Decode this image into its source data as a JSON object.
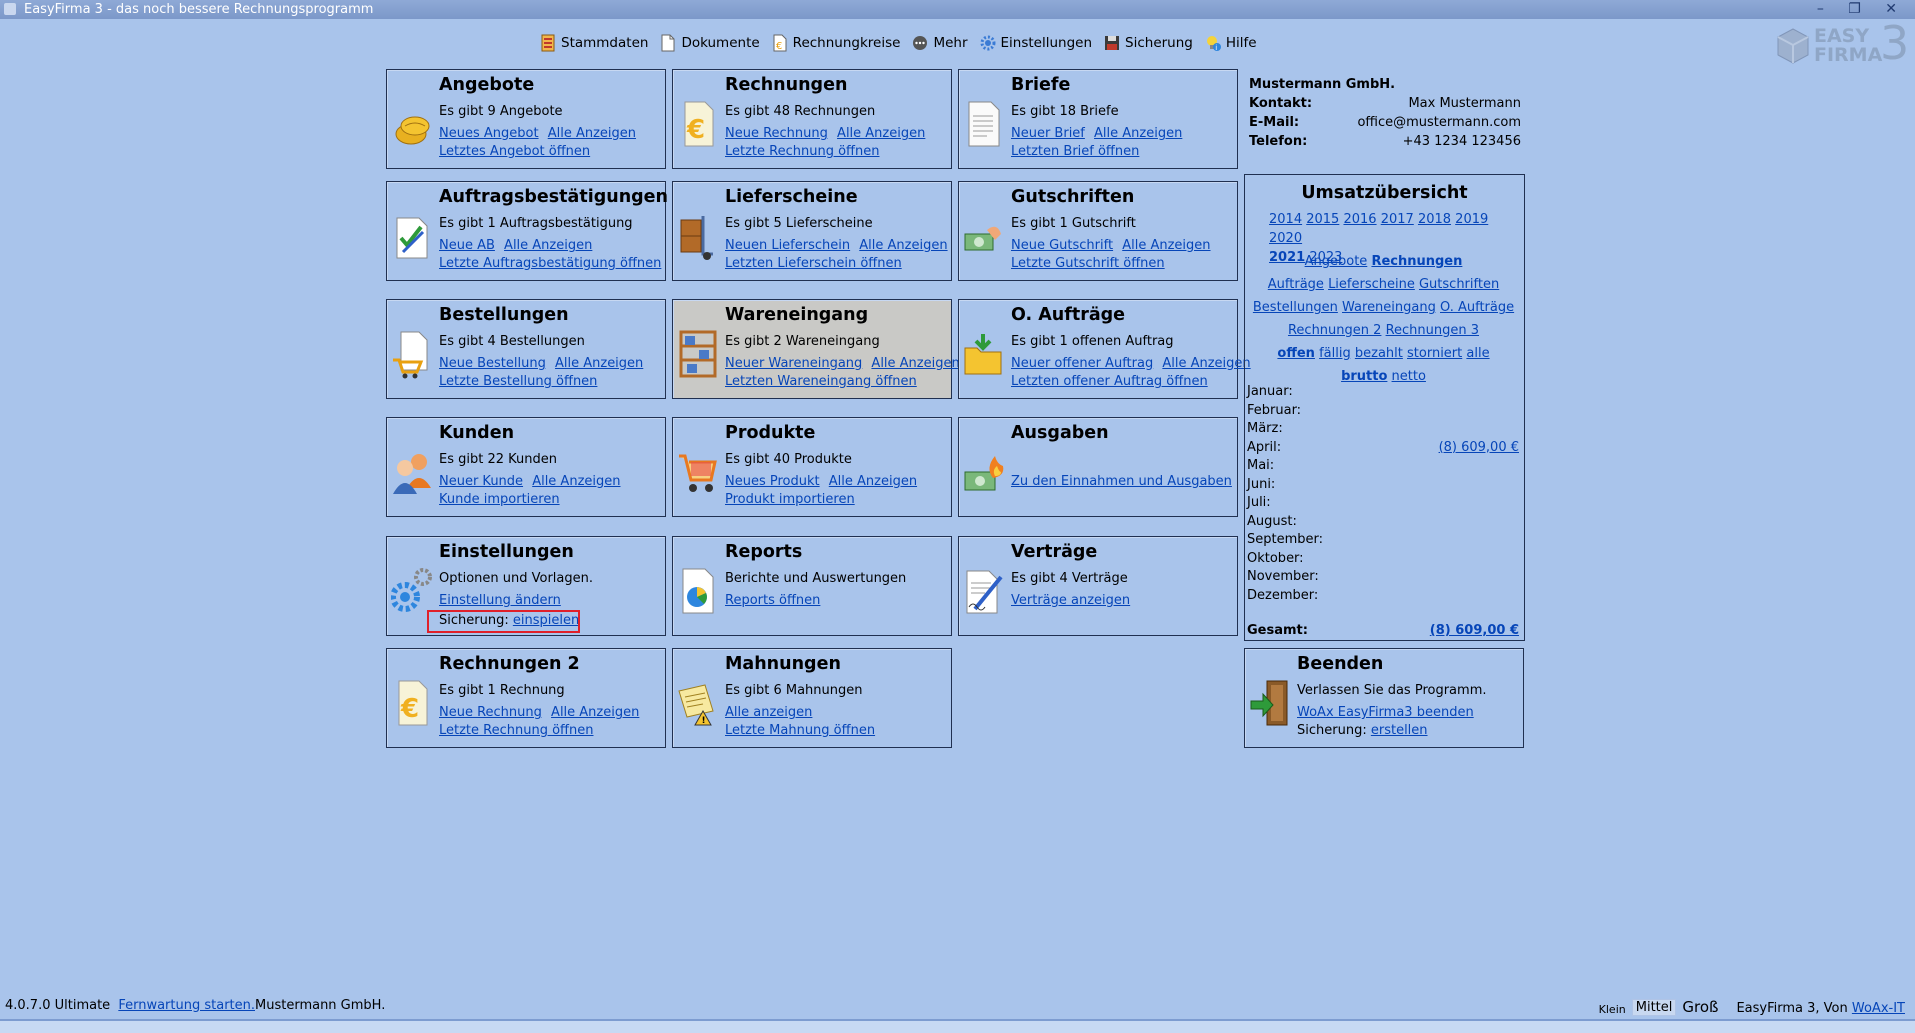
{
  "window": {
    "title": "EasyFirma 3 - das noch bessere Rechnungsprogramm",
    "controls": "–  ❐  ✕"
  },
  "toolbar": {
    "items": [
      {
        "label": "Stammdaten",
        "icon": "stammdaten-icon"
      },
      {
        "label": "Dokumente",
        "icon": "document-icon"
      },
      {
        "label": "Rechnungkreise",
        "icon": "invoice-cycle-icon"
      },
      {
        "label": "Mehr",
        "icon": "more-icon"
      },
      {
        "label": "Einstellungen",
        "icon": "settings-gear-icon"
      },
      {
        "label": "Sicherung",
        "icon": "floppy-disk-icon"
      },
      {
        "label": "Hilfe",
        "icon": "help-bulb-icon"
      }
    ]
  },
  "logo": {
    "line1": "EASY",
    "line2": "FIRMA",
    "num": "3"
  },
  "tiles": {
    "angebote": {
      "title": "Angebote",
      "count": "Es gibt 9 Angebote",
      "new": "Neues Angebot",
      "all": "Alle Anzeigen",
      "last": "Letztes Angebot öffnen"
    },
    "rechnungen": {
      "title": "Rechnungen",
      "count": "Es gibt 48 Rechnungen",
      "new": "Neue Rechnung",
      "all": "Alle Anzeigen",
      "last": "Letzte Rechnung öffnen"
    },
    "briefe": {
      "title": "Briefe",
      "count": "Es gibt 18 Briefe",
      "new": "Neuer Brief",
      "all": "Alle Anzeigen",
      "last": "Letzten Brief öffnen"
    },
    "ab": {
      "title": "Auftragsbestätigungen",
      "count": "Es gibt 1 Auftragsbestätigung",
      "new": "Neue AB",
      "all": "Alle Anzeigen",
      "last": "Letzte Auftragsbestätigung öffnen"
    },
    "lieferscheine": {
      "title": "Lieferscheine",
      "count": "Es gibt 5 Lieferscheine",
      "new": "Neuen Lieferschein",
      "all": "Alle Anzeigen",
      "last": "Letzten Lieferschein öffnen"
    },
    "gutschriften": {
      "title": "Gutschriften",
      "count": "Es gibt 1 Gutschrift",
      "new": "Neue Gutschrift",
      "all": "Alle Anzeigen",
      "last": "Letzte Gutschrift öffnen"
    },
    "bestellungen": {
      "title": "Bestellungen",
      "count": "Es gibt 4 Bestellungen",
      "new": "Neue Bestellung",
      "all": "Alle Anzeigen",
      "last": "Letzte Bestellung öffnen"
    },
    "wareneingang": {
      "title": "Wareneingang",
      "count": "Es gibt 2 Wareneingang",
      "new": "Neuer Wareneingang",
      "all": "Alle Anzeigen",
      "last": "Letzten Wareneingang öffnen"
    },
    "oauftraege": {
      "title": "O. Aufträge",
      "count": "Es gibt 1 offenen Auftrag",
      "new": "Neuer offener Auftrag",
      "all": "Alle Anzeigen",
      "last": "Letzten offener Auftrag öffnen"
    },
    "kunden": {
      "title": "Kunden",
      "count": "Es gibt 22 Kunden",
      "new": "Neuer Kunde",
      "all": "Alle Anzeigen",
      "last": "Kunde importieren"
    },
    "produkte": {
      "title": "Produkte",
      "count": "Es gibt 40 Produkte",
      "new": "Neues Produkt",
      "all": "Alle Anzeigen",
      "last": "Produkt importieren"
    },
    "ausgaben": {
      "title": "Ausgaben",
      "link": "Zu den Einnahmen und Ausgaben"
    },
    "einstellungen": {
      "title": "Einstellungen",
      "desc": "Optionen und Vorlagen.",
      "link": "Einstellung ändern",
      "backup_label": "Sicherung:",
      "backup_link": "einspielen"
    },
    "reports": {
      "title": "Reports",
      "desc": "Berichte und Auswertungen",
      "link": "Reports öffnen"
    },
    "vertraege": {
      "title": "Verträge",
      "count": "Es gibt 4 Verträge",
      "link": "Verträge anzeigen"
    },
    "rechnungen2": {
      "title": "Rechnungen 2",
      "count": "Es gibt 1 Rechnung",
      "new": "Neue Rechnung",
      "all": "Alle Anzeigen",
      "last": "Letzte Rechnung öffnen"
    },
    "mahnungen": {
      "title": "Mahnungen",
      "count": "Es gibt 6 Mahnungen",
      "all": "Alle anzeigen",
      "last": "Letzte Mahnung öffnen"
    },
    "beenden": {
      "title": "Beenden",
      "desc": "Verlassen Sie das Programm.",
      "link": "WoAx EasyFirma3 beenden",
      "backup_label": "Sicherung:",
      "backup_link": "erstellen"
    }
  },
  "company": {
    "name": "Mustermann GmbH.",
    "kontakt_label": "Kontakt:",
    "kontakt": "Max Mustermann",
    "email_label": "E-Mail:",
    "email": "office@mustermann.com",
    "telefon_label": "Telefon:",
    "telefon": "+43 1234 123456"
  },
  "umsatz": {
    "title": "Umsatzübersicht",
    "years": [
      "2014",
      "2015",
      "2016",
      "2017",
      "2018",
      "2019",
      "2020",
      "2021",
      "2023"
    ],
    "selected_year": "2021",
    "types": [
      "Angebote",
      "Rechnungen",
      "Aufträge",
      "Lieferscheine",
      "Gutschriften",
      "Bestellungen",
      "Wareneingang",
      "O. Aufträge",
      "Rechnungen 2",
      "Rechnungen 3"
    ],
    "selected_type": "Rechnungen",
    "status": [
      "offen",
      "fällig",
      "bezahlt",
      "storniert",
      "alle"
    ],
    "selected_status": "offen",
    "tax": [
      "brutto",
      "netto"
    ],
    "selected_tax": "brutto",
    "months": [
      {
        "name": "Januar:",
        "value": ""
      },
      {
        "name": "Februar:",
        "value": ""
      },
      {
        "name": "März:",
        "value": ""
      },
      {
        "name": "April:",
        "value": "(8)  609,00 €"
      },
      {
        "name": "Mai:",
        "value": ""
      },
      {
        "name": "Juni:",
        "value": ""
      },
      {
        "name": "Juli:",
        "value": ""
      },
      {
        "name": "August:",
        "value": ""
      },
      {
        "name": "September:",
        "value": ""
      },
      {
        "name": "Oktober:",
        "value": ""
      },
      {
        "name": "November:",
        "value": ""
      },
      {
        "name": "Dezember:",
        "value": ""
      }
    ],
    "total_label": "Gesamt:",
    "total_value": "(8)  609,00 €"
  },
  "status": {
    "version": "4.0.7.0 Ultimate",
    "remote": "Fernwartung starten.",
    "company": "Mustermann GmbH.",
    "size_small": "Klein",
    "size_medium": "Mittel",
    "size_large": "Groß",
    "credit": "EasyFirma 3, Von",
    "credit_link": "WoAx-IT"
  },
  "colors": {
    "background": "#a9c4eb",
    "link": "#0645b8",
    "highlight_box": "#e0202a",
    "tile_hover": "#c9c9c6"
  }
}
